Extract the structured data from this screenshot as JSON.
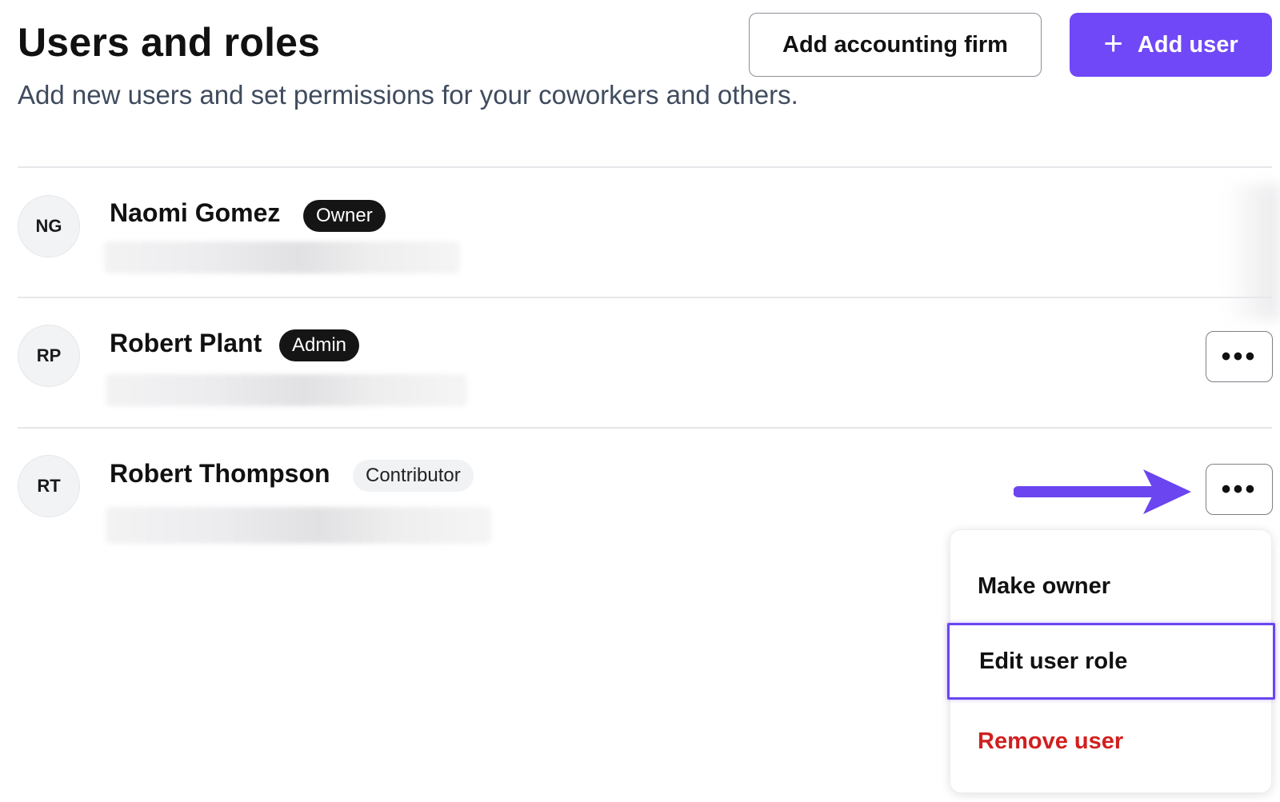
{
  "header": {
    "title": "Users and roles",
    "subtitle": "Add new users and set permissions for your coworkers and others.",
    "add_accounting_firm_label": "Add accounting firm",
    "add_user_label": "Add user",
    "add_user_icon": "plus-icon"
  },
  "users": [
    {
      "initials": "NG",
      "name": "Naomi Gomez",
      "role": "Owner"
    },
    {
      "initials": "RP",
      "name": "Robert Plant",
      "role": "Admin",
      "menu_icon": "more-horizontal-icon"
    },
    {
      "initials": "RT",
      "name": "Robert Thompson",
      "role": "Contributor",
      "menu_icon": "more-horizontal-icon"
    }
  ],
  "menu": {
    "items": [
      {
        "label": "Make owner"
      },
      {
        "label": "Edit user role",
        "highlighted": true
      },
      {
        "label": "Remove user",
        "color": "#d0201f"
      }
    ]
  },
  "colors": {
    "accent": "#7048f7",
    "danger": "#d0201f",
    "badge_dark": "#151515",
    "badge_light": "#f1f2f4"
  }
}
